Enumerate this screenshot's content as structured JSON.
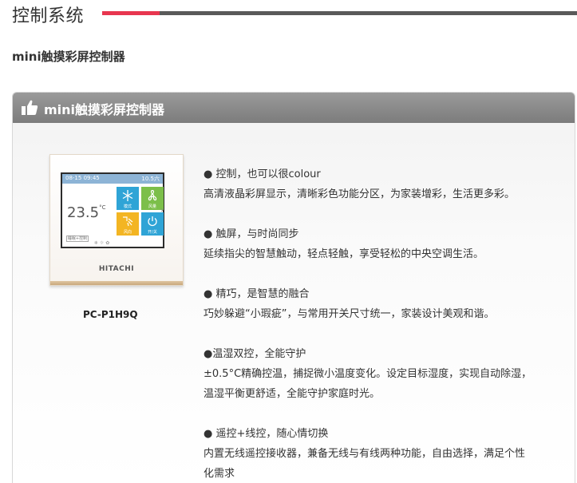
{
  "page": {
    "title": "控制系统",
    "subtitle": "mini触摸彩屏控制器"
  },
  "panel": {
    "title": "mini触摸彩屏控制器",
    "icon": "thumbs-up-icon"
  },
  "device": {
    "screen_time": "08-15  09:45",
    "screen_date": "10.5六",
    "screen_temp": "23.5",
    "screen_temp_unit": "°C",
    "screen_mode": "睡眠+控制",
    "tiles": [
      "模式",
      "风量",
      "风向",
      "开/关"
    ],
    "brand": "HITACHI",
    "model": "PC-P1H9Q"
  },
  "features": [
    {
      "title": "● 控制，也可以很colour",
      "desc": [
        "高清液晶彩屏显示，清晰彩色功能分区，为家装增彩，生活更多彩。"
      ]
    },
    {
      "title": "● 触屏，与时尚同步",
      "desc": [
        "延续指尖的智慧触动，轻点轻触，享受轻松的中央空调生活。"
      ]
    },
    {
      "title": "● 精巧，是智慧的融合",
      "desc": [
        "巧妙躲避“小瑕疵”，与常用开关尺寸统一，家装设计美观和谐。"
      ]
    },
    {
      "title": "●温湿双控，全能守护",
      "desc": [
        "±0.5°C精确控温，捕捉微小温度变化。设定目标湿度，实现自动除湿，",
        "温湿平衡更舒适，全能守护家庭时光。"
      ]
    },
    {
      "title": "● 遥控+线控，随心情切换",
      "desc": [
        "内置无线遥控接收器，兼备无线与有线两种功能，自由选择，满足个性",
        "化需求"
      ]
    }
  ],
  "colors": {
    "accent": "#e8364f",
    "title_bar": "#5a5a5a",
    "panel_head": "#8a8a8a"
  }
}
